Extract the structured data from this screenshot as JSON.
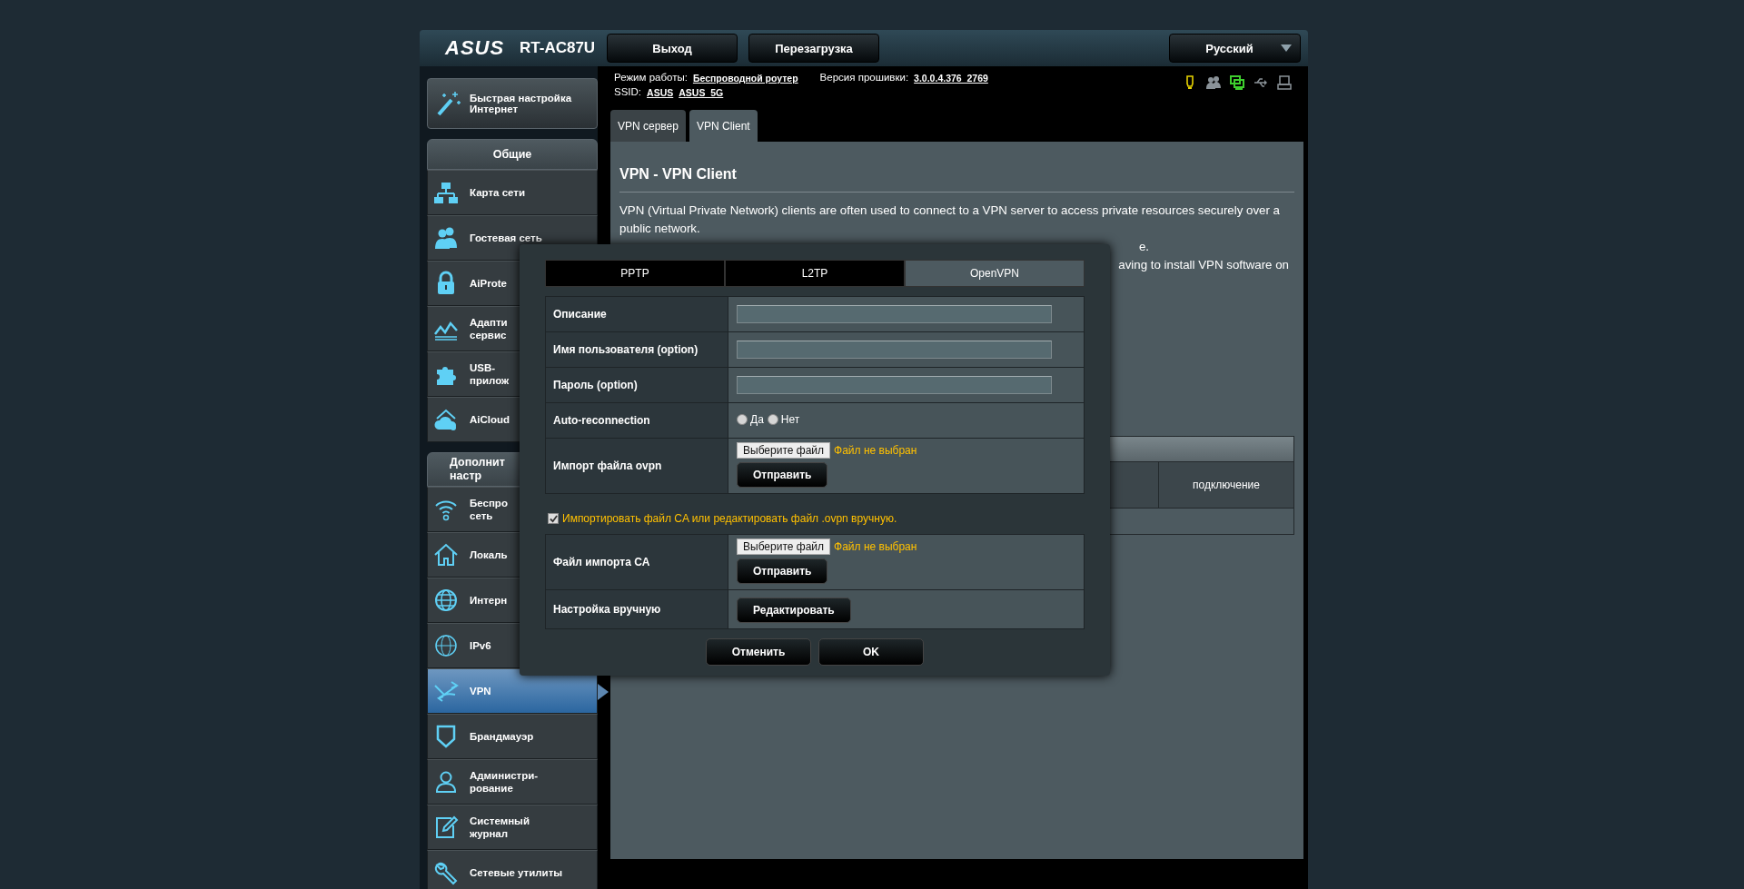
{
  "header": {
    "logo": "ASUS",
    "model": "RT-AC87U",
    "buttons": [
      "Выход",
      "Перезагрузка"
    ],
    "language": "Русский"
  },
  "quick_setup": {
    "lines": [
      "Быстрая настройка",
      "Интернет"
    ]
  },
  "sidebar": {
    "groups": [
      {
        "title": [
          "Общие"
        ],
        "items": [
          {
            "lines": [
              "Карта сети"
            ],
            "selected": false
          },
          {
            "lines": [
              "Гостевая сеть"
            ],
            "selected": false
          },
          {
            "lines": [
              "AiProte"
            ],
            "selected": false
          },
          {
            "lines": [
              "Адапти",
              "сервис"
            ],
            "selected": false
          },
          {
            "lines": [
              "USB-",
              "прилож"
            ],
            "selected": false
          },
          {
            "lines": [
              "AiCloud"
            ],
            "selected": false
          }
        ]
      },
      {
        "title": [
          "Дополнит",
          "настр"
        ],
        "items": [
          {
            "lines": [
              "Беспро",
              "сеть"
            ],
            "selected": false
          },
          {
            "lines": [
              "Локаль"
            ],
            "selected": false
          },
          {
            "lines": [
              "Интерн"
            ],
            "selected": false
          },
          {
            "lines": [
              "IPv6"
            ],
            "selected": false
          },
          {
            "lines": [
              "VPN"
            ],
            "selected": true
          },
          {
            "lines": [
              "Брандмауэр"
            ],
            "selected": false
          },
          {
            "lines": [
              "Администри-",
              "рование"
            ],
            "selected": false
          },
          {
            "lines": [
              "Системный",
              "журнал"
            ],
            "selected": false
          },
          {
            "lines": [
              "Сетевые утилиты"
            ],
            "selected": false
          }
        ]
      }
    ]
  },
  "info": {
    "mode_label": "Режим работы:",
    "mode_value": "Беспроводной роутер",
    "firmware_label": "Версия прошивки:",
    "firmware_value": "3.0.0.4.376_2769",
    "ssid_label": "SSID:",
    "ssids": [
      "ASUS",
      "ASUS_5G"
    ]
  },
  "status_icons": [
    {
      "kind": "lamp",
      "color": "#e6d200"
    },
    {
      "kind": "clients",
      "color": "#8a9298"
    },
    {
      "kind": "monitor",
      "color": "#3ecf2e"
    },
    {
      "kind": "usb",
      "color": "#8a9298"
    },
    {
      "kind": "printer",
      "color": "#8a9298"
    }
  ],
  "tabs": [
    {
      "label": "VPN сервер",
      "selected": false
    },
    {
      "label": "VPN Client",
      "selected": true
    }
  ],
  "content": {
    "title": "VPN - VPN Client",
    "paragraph": "VPN (Virtual Private Network) clients are often used to connect to a VPN server to access private resources securely over a public network.",
    "fragments": [
      "e.",
      "aving to install VPN software on"
    ],
    "table": {
      "column": "подключение"
    }
  },
  "dialog": {
    "tabs": [
      {
        "label": "PPTP",
        "selected": false
      },
      {
        "label": "L2TP",
        "selected": false
      },
      {
        "label": "OpenVPN",
        "selected": true
      }
    ],
    "rows": [
      {
        "kind": "text",
        "label": "Описание"
      },
      {
        "kind": "text",
        "label": "Имя пользователя (option)"
      },
      {
        "kind": "text",
        "label": "Пароль (option)"
      },
      {
        "kind": "radio",
        "label": "Auto-reconnection",
        "options": [
          {
            "label": "Да",
            "selected": false
          },
          {
            "label": "Нет",
            "selected": false
          }
        ]
      },
      {
        "kind": "file",
        "label": "Импорт файла ovpn",
        "choose": "Выберите файл",
        "status": "Файл не выбран",
        "submit": "Отправить"
      }
    ],
    "checkbox": {
      "label": "Импортировать файл CA или редактировать файл .ovpn вручную.",
      "checked": true
    },
    "rows2": [
      {
        "kind": "file",
        "label": "Файл импорта CA",
        "choose": "Выберите файл",
        "status": "Файл не выбран",
        "submit": "Отправить"
      },
      {
        "kind": "button",
        "label": "Настройка вручную",
        "button": "Редактировать"
      }
    ],
    "buttons": [
      "Отменить",
      "OK"
    ]
  }
}
